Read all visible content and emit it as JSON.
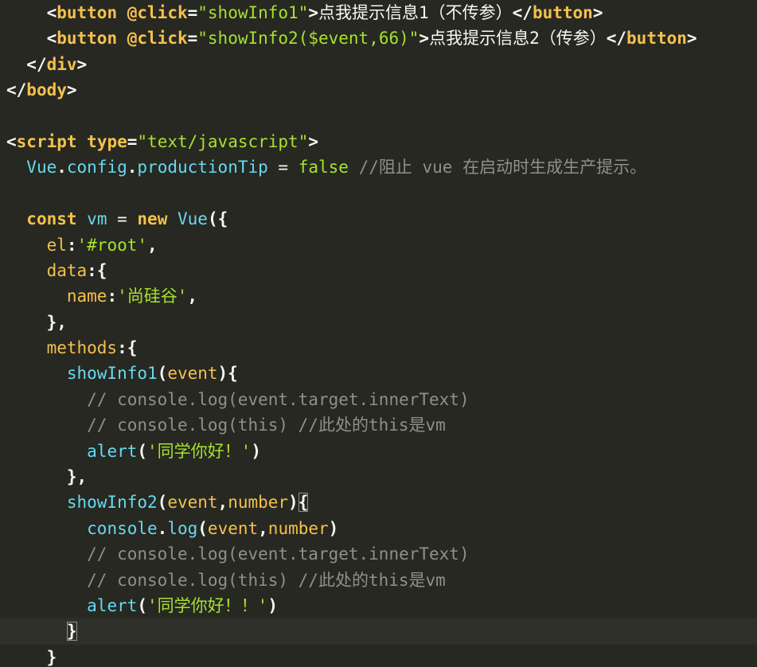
{
  "editor": {
    "lines": [
      {
        "indent": "    ",
        "tokens": [
          [
            "p",
            "<"
          ],
          [
            "k",
            "button"
          ],
          [
            "n",
            " "
          ],
          [
            "a",
            "@click"
          ],
          [
            "p",
            "="
          ],
          [
            "s",
            "\"showInfo1\""
          ],
          [
            "p",
            ">"
          ],
          [
            "cn",
            "点我提示信息1（不传参）"
          ],
          [
            "p",
            "</"
          ],
          [
            "k",
            "button"
          ],
          [
            "p",
            ">"
          ]
        ]
      },
      {
        "indent": "    ",
        "tokens": [
          [
            "p",
            "<"
          ],
          [
            "k",
            "button"
          ],
          [
            "n",
            " "
          ],
          [
            "a",
            "@click"
          ],
          [
            "p",
            "="
          ],
          [
            "s",
            "\"showInfo2($event,66)\""
          ],
          [
            "p",
            ">"
          ],
          [
            "cn",
            "点我提示信息2（传参）"
          ],
          [
            "p",
            "</"
          ],
          [
            "k",
            "button"
          ],
          [
            "p",
            ">"
          ]
        ]
      },
      {
        "indent": "  ",
        "tokens": [
          [
            "p",
            "</"
          ],
          [
            "k",
            "div"
          ],
          [
            "p",
            ">"
          ]
        ]
      },
      {
        "indent": "",
        "tokens": [
          [
            "p",
            "</"
          ],
          [
            "k",
            "body"
          ],
          [
            "p",
            ">"
          ]
        ]
      },
      {
        "indent": "",
        "tokens": []
      },
      {
        "indent": "",
        "tokens": [
          [
            "p",
            "<"
          ],
          [
            "k",
            "script"
          ],
          [
            "n",
            " "
          ],
          [
            "a",
            "type"
          ],
          [
            "p",
            "="
          ],
          [
            "s",
            "\"text/javascript\""
          ],
          [
            "p",
            ">"
          ]
        ]
      },
      {
        "indent": "  ",
        "tokens": [
          [
            "v",
            "Vue"
          ],
          [
            "p",
            "."
          ],
          [
            "v",
            "config"
          ],
          [
            "p",
            "."
          ],
          [
            "v",
            "productionTip"
          ],
          [
            "n",
            " = "
          ],
          [
            "b",
            "false"
          ],
          [
            "n",
            " "
          ],
          [
            "c",
            "//阻止 vue 在启动时生成生产提示。"
          ]
        ]
      },
      {
        "indent": "",
        "tokens": []
      },
      {
        "indent": "  ",
        "tokens": [
          [
            "k",
            "const"
          ],
          [
            "n",
            " "
          ],
          [
            "v",
            "vm"
          ],
          [
            "n",
            " = "
          ],
          [
            "k",
            "new"
          ],
          [
            "n",
            " "
          ],
          [
            "v",
            "Vue"
          ],
          [
            "p",
            "({"
          ]
        ]
      },
      {
        "indent": "    ",
        "tokens": [
          [
            "prop",
            "el"
          ],
          [
            "p",
            ":"
          ],
          [
            "s",
            "'#root'"
          ],
          [
            "p",
            ","
          ]
        ]
      },
      {
        "indent": "    ",
        "tokens": [
          [
            "prop",
            "data"
          ],
          [
            "p",
            ":{"
          ]
        ]
      },
      {
        "indent": "      ",
        "tokens": [
          [
            "prop",
            "name"
          ],
          [
            "p",
            ":"
          ],
          [
            "s",
            "'尚硅谷'"
          ],
          [
            "p",
            ","
          ]
        ]
      },
      {
        "indent": "    ",
        "tokens": [
          [
            "p",
            "},"
          ]
        ]
      },
      {
        "indent": "    ",
        "tokens": [
          [
            "prop",
            "methods"
          ],
          [
            "p",
            ":{"
          ]
        ]
      },
      {
        "indent": "      ",
        "tokens": [
          [
            "f",
            "showInfo1"
          ],
          [
            "p",
            "("
          ],
          [
            "prop",
            "event"
          ],
          [
            "p",
            "){"
          ]
        ]
      },
      {
        "indent": "        ",
        "tokens": [
          [
            "c",
            "// console.log(event.target.innerText)"
          ]
        ]
      },
      {
        "indent": "        ",
        "tokens": [
          [
            "c",
            "// console.log(this) //此处的this是vm"
          ]
        ]
      },
      {
        "indent": "        ",
        "tokens": [
          [
            "f",
            "alert"
          ],
          [
            "p",
            "("
          ],
          [
            "s",
            "'同学你好！'"
          ],
          [
            "p",
            ")"
          ]
        ]
      },
      {
        "indent": "      ",
        "tokens": [
          [
            "p",
            "},"
          ]
        ]
      },
      {
        "indent": "      ",
        "tokens": [
          [
            "f",
            "showInfo2"
          ],
          [
            "p",
            "("
          ],
          [
            "prop",
            "event"
          ],
          [
            "p",
            ","
          ],
          [
            "prop",
            "number"
          ],
          [
            "p",
            ")"
          ],
          [
            "bm",
            "{"
          ]
        ]
      },
      {
        "indent": "        ",
        "tokens": [
          [
            "f",
            "console"
          ],
          [
            "p",
            "."
          ],
          [
            "f",
            "log"
          ],
          [
            "p",
            "("
          ],
          [
            "prop",
            "event"
          ],
          [
            "p",
            ","
          ],
          [
            "prop",
            "number"
          ],
          [
            "p",
            ")"
          ]
        ]
      },
      {
        "indent": "        ",
        "tokens": [
          [
            "c",
            "// console.log(event.target.innerText)"
          ]
        ]
      },
      {
        "indent": "        ",
        "tokens": [
          [
            "c",
            "// console.log(this) //此处的this是vm"
          ]
        ]
      },
      {
        "indent": "        ",
        "tokens": [
          [
            "f",
            "alert"
          ],
          [
            "p",
            "("
          ],
          [
            "s",
            "'同学你好！！'"
          ],
          [
            "p",
            ")"
          ]
        ]
      },
      {
        "indent": "      ",
        "tokens": [
          [
            "bm",
            "}"
          ]
        ],
        "current": true
      },
      {
        "indent": "    ",
        "tokens": [
          [
            "p",
            "}"
          ]
        ]
      }
    ]
  },
  "colors": {
    "background": "#272822",
    "keyword": "#f4c14d",
    "string": "#a6e22e",
    "identifier": "#66d9ef",
    "comment": "#8f908a",
    "text": "#f8f8f2"
  }
}
